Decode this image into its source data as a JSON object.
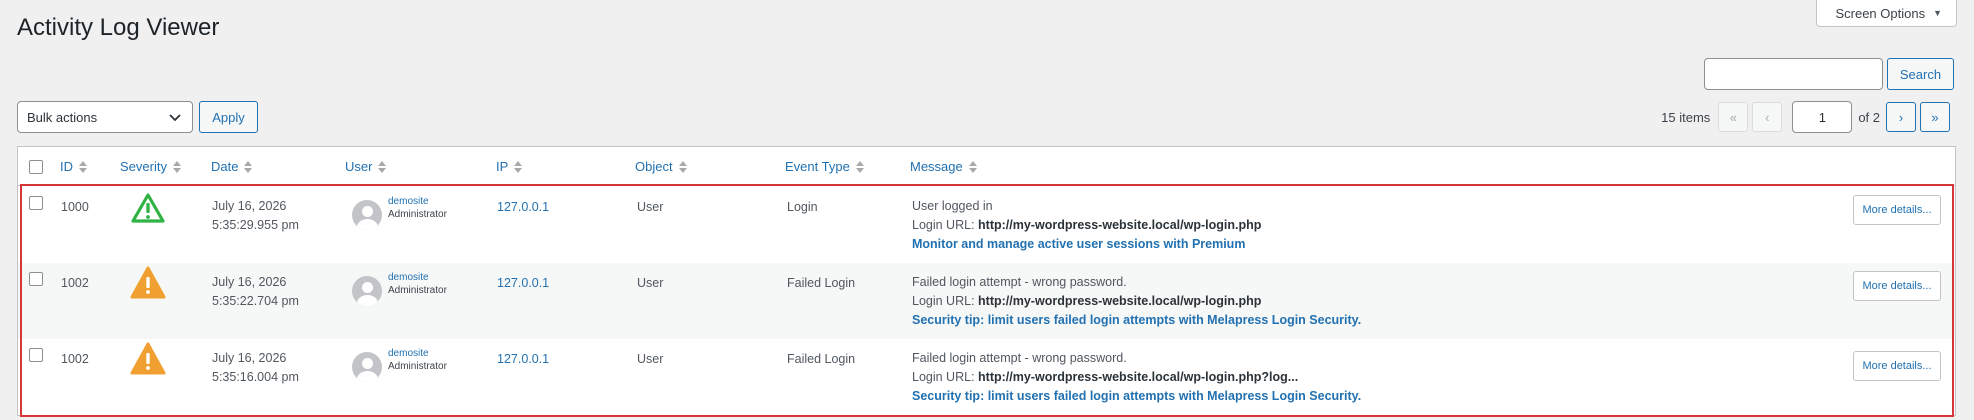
{
  "page": {
    "title": "Activity Log Viewer"
  },
  "screen_options": {
    "label": "Screen Options"
  },
  "search": {
    "value": "",
    "button_label": "Search"
  },
  "bulk": {
    "selected": "Bulk actions",
    "apply_label": "Apply"
  },
  "pagination": {
    "items_count": "15 items",
    "first": "«",
    "prev": "‹",
    "current_page": "1",
    "of_label": "of 2",
    "next": "›",
    "last": "»"
  },
  "columns": {
    "id": "ID",
    "severity": "Severity",
    "date": "Date",
    "user": "User",
    "ip": "IP",
    "object": "Object",
    "event_type": "Event Type",
    "message": "Message"
  },
  "rows": [
    {
      "id": "1000",
      "severity": "success",
      "severity_icon": "warning-triangle-green-icon",
      "date": "July 16, 2026",
      "time": "5:35:29.955 pm",
      "user_name": "demosite",
      "user_role": "Administrator",
      "ip": "127.0.0.1",
      "object": "User",
      "event_type": "Login",
      "message_line1": "User logged in",
      "login_url_label": "Login URL:",
      "login_url": "http://my-wordpress-website.local/wp-login.php",
      "promo": "Monitor and manage active user sessions with Premium",
      "more_label": "More details..."
    },
    {
      "id": "1002",
      "severity": "warning",
      "severity_icon": "warning-triangle-orange-icon",
      "date": "July 16, 2026",
      "time": "5:35:22.704 pm",
      "user_name": "demosite",
      "user_role": "Administrator",
      "ip": "127.0.0.1",
      "object": "User",
      "event_type": "Failed Login",
      "message_line1": "Failed login attempt - wrong password.",
      "login_url_label": "Login URL:",
      "login_url": "http://my-wordpress-website.local/wp-login.php",
      "promo": "Security tip: limit users failed login attempts with Melapress Login Security.",
      "more_label": "More details..."
    },
    {
      "id": "1002",
      "severity": "warning",
      "severity_icon": "warning-triangle-orange-icon",
      "date": "July 16, 2026",
      "time": "5:35:16.004 pm",
      "user_name": "demosite",
      "user_role": "Administrator",
      "ip": "127.0.0.1",
      "object": "User",
      "event_type": "Failed Login",
      "message_line1": "Failed login attempt - wrong password.",
      "login_url_label": "Login URL:",
      "login_url": "http://my-wordpress-website.local/wp-login.php?log...",
      "promo": "Security tip: limit users failed login attempts with Melapress Login Security.",
      "more_label": "More details..."
    }
  ],
  "colors": {
    "accent": "#2271b1",
    "success": "#2fb344",
    "warning": "#f0a030",
    "highlight": "#d63638"
  }
}
